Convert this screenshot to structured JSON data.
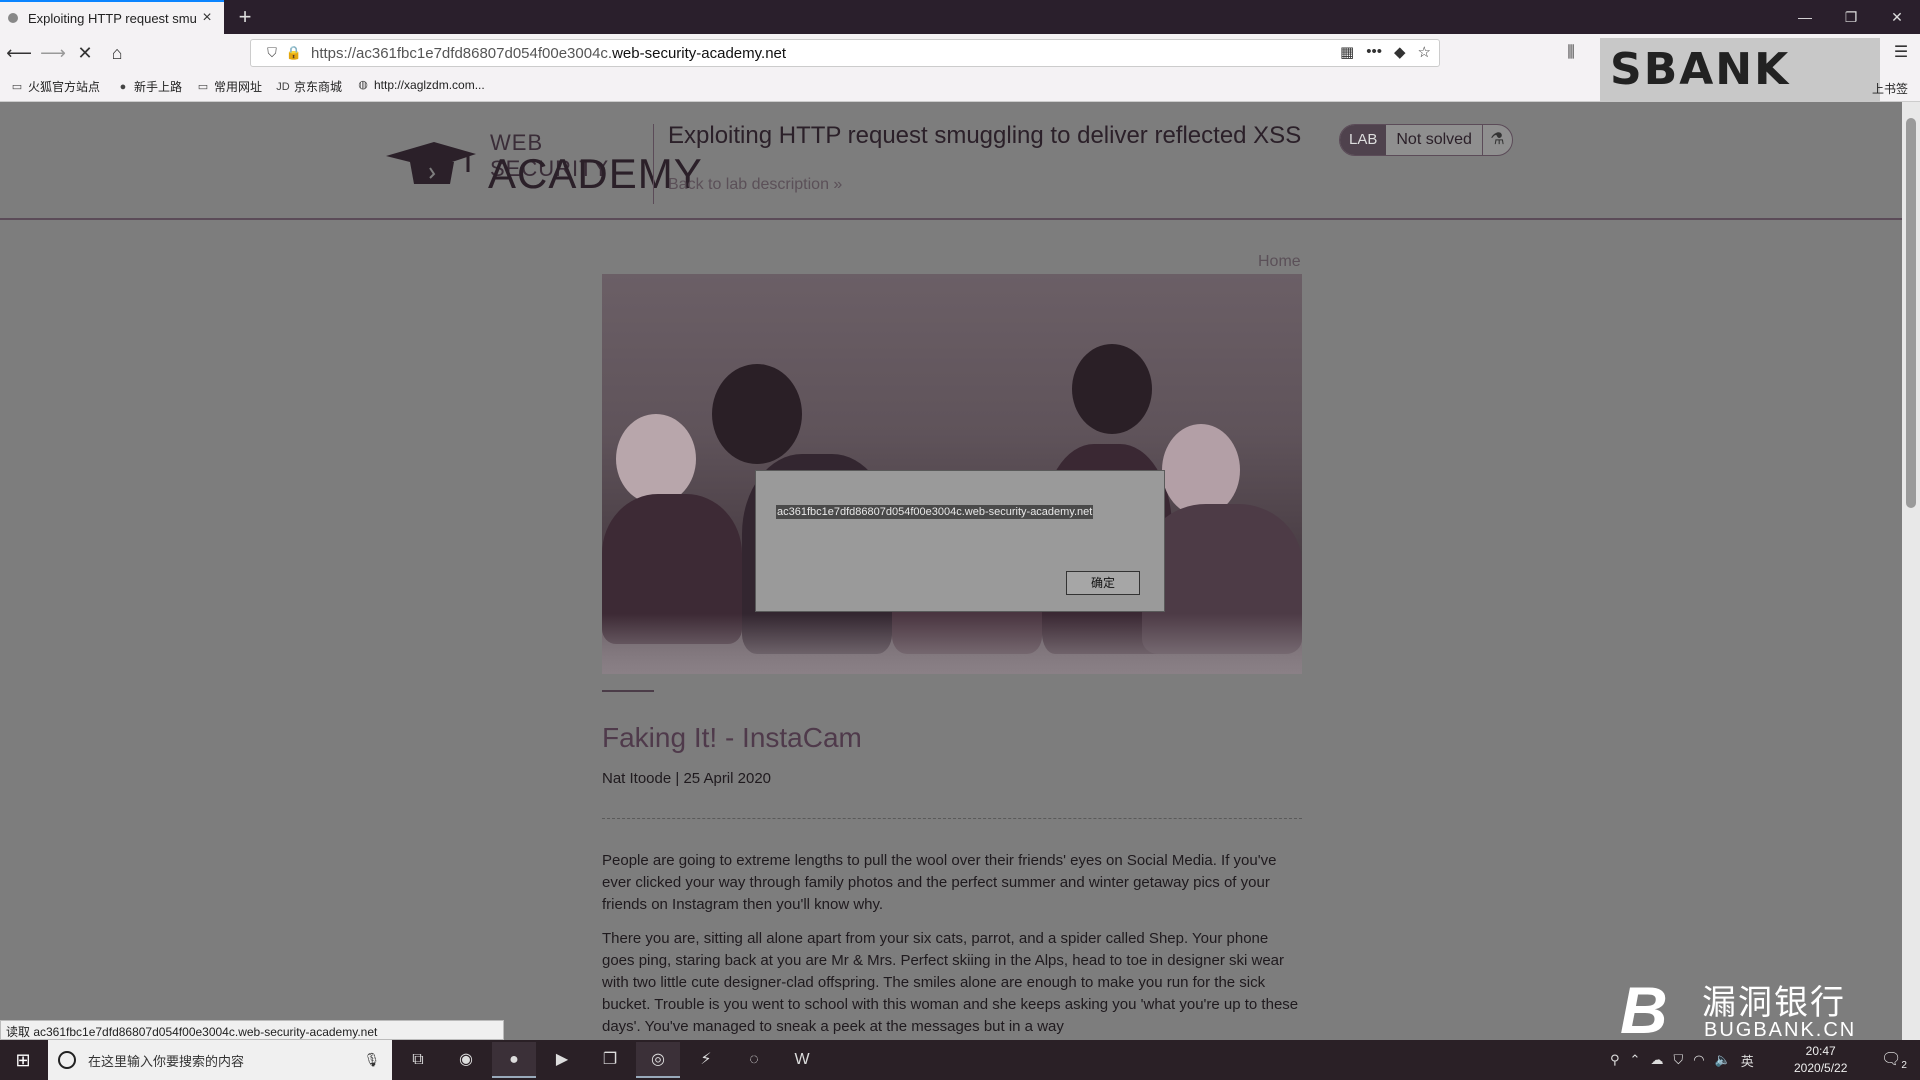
{
  "browser": {
    "tab_title": "Exploiting HTTP request smu",
    "new_tab": "+",
    "url_prefix": "https://ac361fbc1e7dfd86807d054f00e3004c.",
    "url_host": "web-security-academy.net",
    "bookmarks": [
      {
        "label": "火狐官方站点",
        "icon": "folder-icon"
      },
      {
        "label": "新手上路",
        "icon": "firefox-icon"
      },
      {
        "label": "常用网址",
        "icon": "folder-icon"
      },
      {
        "label": "京东商城",
        "icon": "jd-icon"
      },
      {
        "label": "http://xaglzdm.com...",
        "icon": "globe-icon"
      }
    ],
    "bookmarks_tail": "上书签",
    "status_text": "读取 ac361fbc1e7dfd86807d054f00e3004c.web-security-academy.net"
  },
  "header": {
    "logo_line1": "WEB SECURITY",
    "logo_line2": "ACADEMY",
    "lab_title": "Exploiting HTTP request smuggling to deliver reflected XSS",
    "back_link": "Back to lab description »",
    "badge_lab": "LAB",
    "badge_status": "Not solved"
  },
  "blog": {
    "home_link": "Home",
    "post_title": "Faking It! - InstaCam",
    "byline": "Nat Itoode | 25 April 2020",
    "paragraphs": [
      "People are going to extreme lengths to pull the wool over their friends' eyes on Social Media. If you've ever clicked your way through family photos and the perfect summer and winter getaway pics of your friends on Instagram then you'll know why.",
      "There you are, sitting all alone apart from your six cats, parrot, and a spider called Shep. Your phone goes ping, staring back at you are Mr & Mrs. Perfect skiing in the Alps, head to toe in designer ski wear with two little cute designer-clad offspring. The smiles alone are enough to make you run for the sick bucket. Trouble is you went to school with this woman and she keeps asking you 'what you're up to these days'. You've managed to sneak a peek at the messages but in a way"
    ]
  },
  "dialog": {
    "message": "ac361fbc1e7dfd86807d054f00e3004c.web-security-academy.net",
    "ok_label": "确定"
  },
  "watermarks": {
    "top": "SBANK",
    "cn": "漏洞银行",
    "en": "BUGBANK.CN"
  },
  "taskbar": {
    "search_placeholder": "在这里输入你要搜索的内容",
    "ime": "英",
    "time": "20:47",
    "date": "2020/5/22",
    "notification_count": "2"
  },
  "colors": {
    "overlay_gray": "#808080",
    "brand_dark": "#2b2029",
    "accent_plum": "#4f3a4b",
    "taskbar": "#2a2026"
  }
}
